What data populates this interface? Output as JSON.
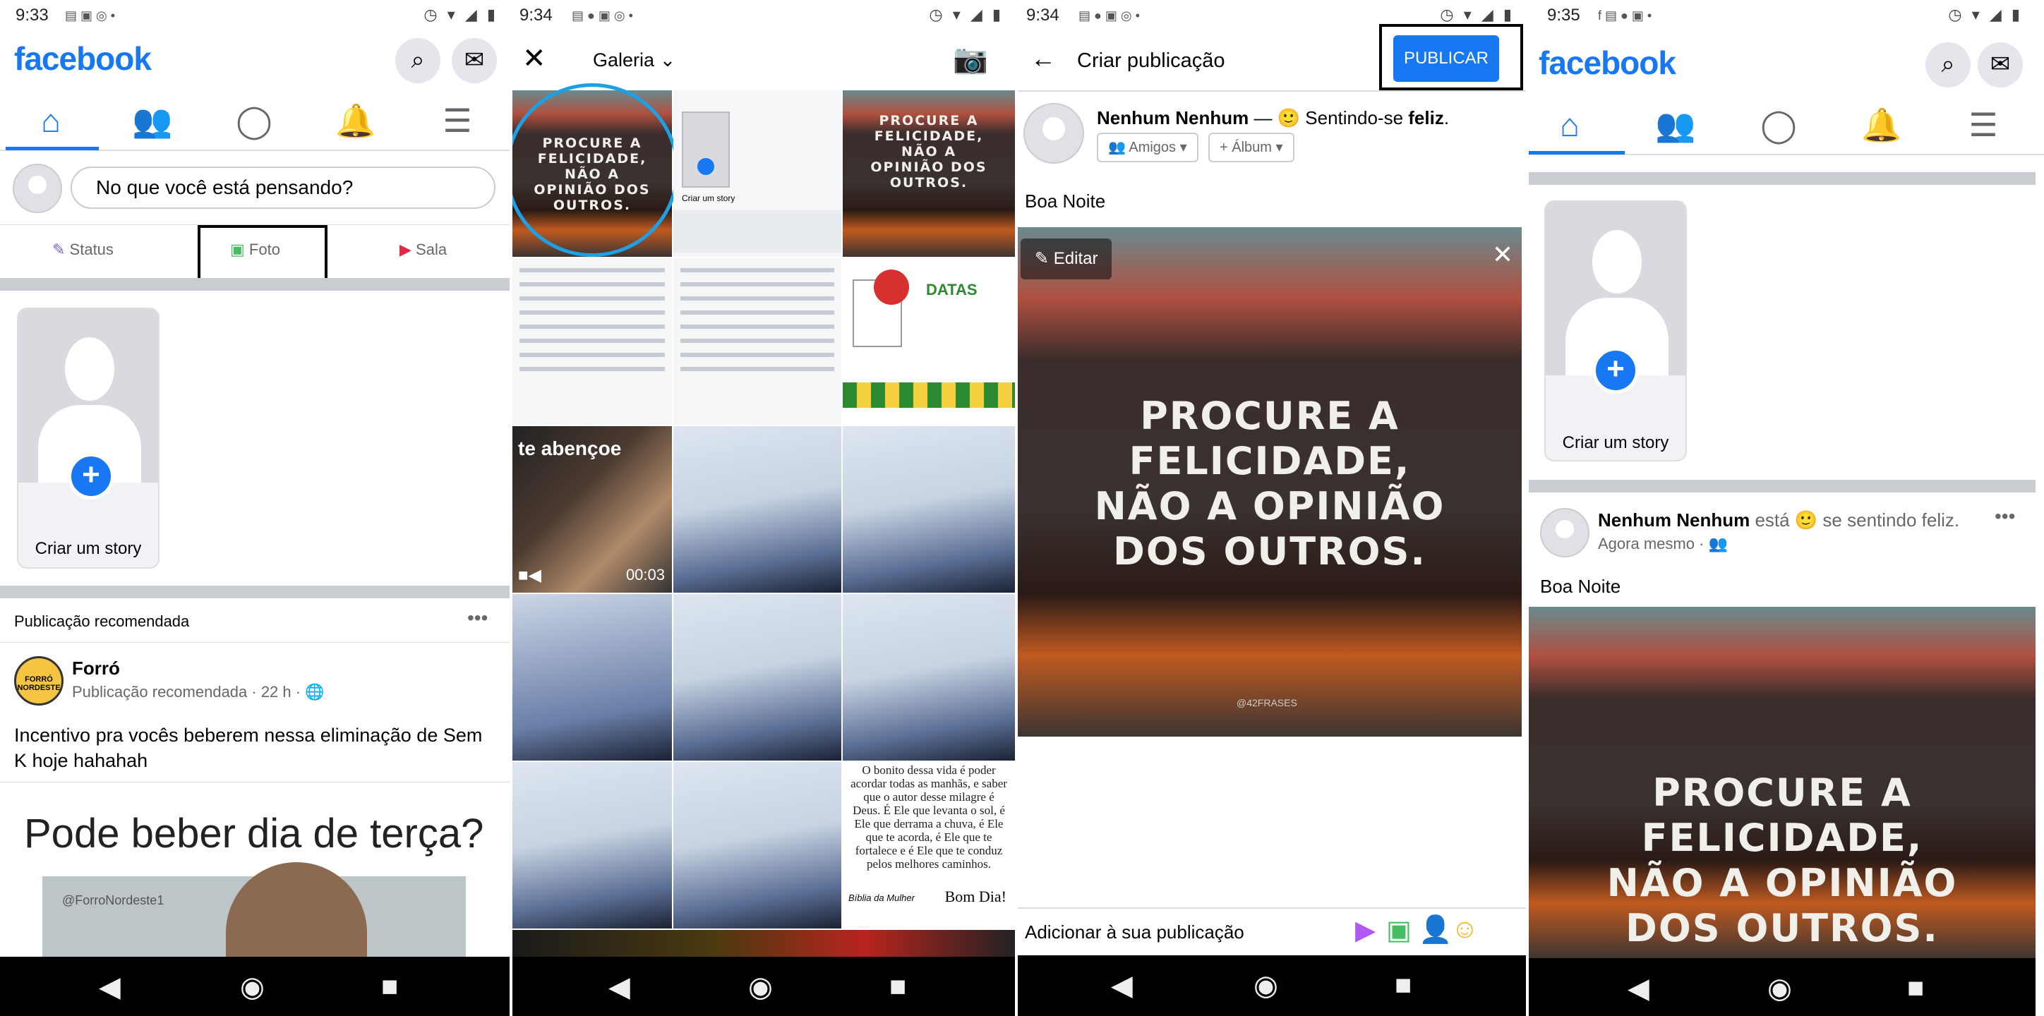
{
  "colors": {
    "brand": "#1877f2",
    "bg": "#ffffff",
    "divider": "#c9ccd1"
  },
  "panel1": {
    "status_time": "9:33",
    "logo": "facebook",
    "composer_placeholder": "No que você está pensando?",
    "actions": {
      "status": "Status",
      "photo": "Foto",
      "room": "Sala"
    },
    "story_label": "Criar um story",
    "section_header": "Publicação recomendada",
    "post": {
      "page_name": "Forró",
      "page_logo_text": "FORRÓ NORDESTE",
      "meta": "Publicação recomendada · 22 h ·",
      "text": "Incentivo pra vocês beberem nessa eliminação de Sem K hoje hahahah",
      "image_caption": "Pode beber dia de terça?",
      "watermark": "@ForroNordeste1"
    }
  },
  "panel2": {
    "status_time": "9:34",
    "title": "Galeria",
    "quote": "PROCURE A FELICIDADE, NÃO A OPINIÃO DOS OUTROS.",
    "video_label": "te abençoe",
    "video_duration": "00:03",
    "datas_title": "DATAS",
    "doc_text": "O bonito dessa vida é poder acordar todas as manhãs, e saber que o autor desse milagre é Deus. É Ele que levanta o sol, é Ele que derrama a chuva, é Ele que te acorda, é Ele que te fortalece e é Ele que te conduz pelos melhores caminhos.",
    "doc_footer": "Bom Dia!",
    "doc_brand": "Bíblia da Mulher",
    "create_story": "Criar um story"
  },
  "panel3": {
    "status_time": "9:34",
    "header_title": "Criar publicação",
    "publish": "PUBLICAR",
    "user_name": "Nenhum Nenhum",
    "feeling_prefix": " — 🙂 Sentindo-se ",
    "feeling": "feliz",
    "feeling_suffix": ".",
    "audience": "Amigos",
    "album": "+ Álbum",
    "post_text": "Boa Noite",
    "edit": "Editar",
    "quote": "PROCURE A FELICIDADE, NÃO A OPINIÃO DOS OUTROS.",
    "watermark": "@42FRASES",
    "add_to_post": "Adicionar à sua publicação"
  },
  "panel4": {
    "status_time": "9:35",
    "logo": "facebook",
    "story_label": "Criar um story",
    "user_name": "Nenhum Nenhum",
    "feeling_text": " está 🙂 se sentindo feliz.",
    "meta": "Agora mesmo ·",
    "post_text": "Boa Noite",
    "quote": "PROCURE A FELICIDADE, NÃO A OPINIÃO DOS OUTROS."
  }
}
